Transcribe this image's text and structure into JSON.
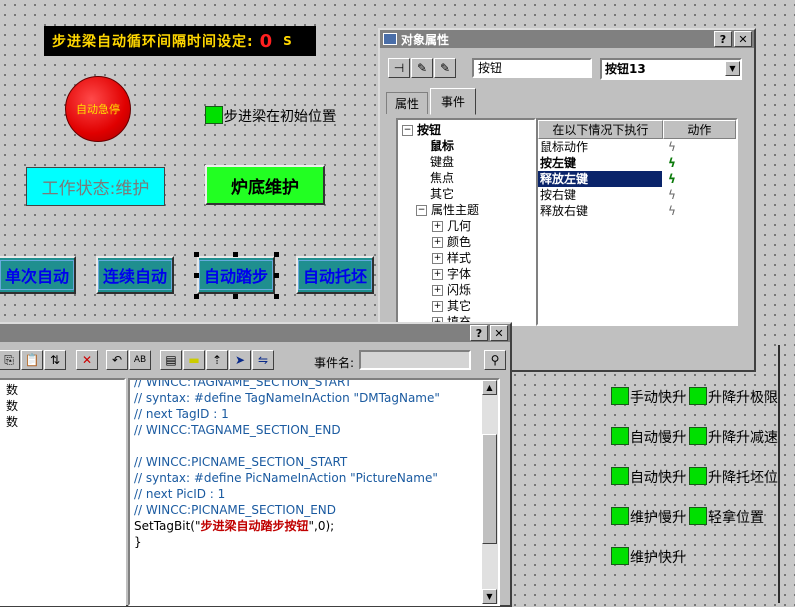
{
  "banner": {
    "label": "步进梁自动循环间隔时间设定:",
    "value": "0",
    "unit": "S"
  },
  "estop": {
    "label": "自动急停"
  },
  "init_position": {
    "label": "步进梁在初始位置"
  },
  "work_state": {
    "label": "工作状态:维护"
  },
  "furnace_btn": {
    "label": "炉底维护"
  },
  "mode_buttons": [
    {
      "label": "单次自动"
    },
    {
      "label": "连续自动"
    },
    {
      "label": "自动踏步"
    },
    {
      "label": "自动托坯"
    }
  ],
  "indicators": [
    {
      "label": "手动快升"
    },
    {
      "label": "升降升极限"
    },
    {
      "label": "自动慢升"
    },
    {
      "label": "升降升减速"
    },
    {
      "label": "自动快升"
    },
    {
      "label": "升降托坯位"
    },
    {
      "label": "维护慢升"
    },
    {
      "label": "轻拿位置"
    },
    {
      "label": "维护快升"
    }
  ],
  "props_dialog": {
    "title": "对象属性",
    "object_type": "按钮",
    "object_name": "按钮13",
    "tabs": [
      "属性",
      "事件"
    ],
    "tree": {
      "root": "按钮",
      "children": [
        "鼠标",
        "键盘",
        "焦点",
        "其它"
      ],
      "theme": "属性主题",
      "theme_children": [
        "几何",
        "颜色",
        "样式",
        "字体",
        "闪烁",
        "其它",
        "填充"
      ]
    },
    "list_headers": [
      "在以下情况下执行",
      "动作"
    ],
    "list_rows": [
      "鼠标动作",
      "按左键",
      "释放左键",
      "按右键",
      "释放右键"
    ]
  },
  "code_dialog": {
    "event_label": "事件名:",
    "left_items": [
      "数",
      "数",
      "数"
    ],
    "code": [
      "// WINCC:TAGNAME_SECTION_START",
      "// syntax: #define TagNameInAction \"DMTagName\"",
      "// next TagID : 1",
      "// WINCC:TAGNAME_SECTION_END",
      "",
      "// WINCC:PICNAME_SECTION_START",
      "// syntax: #define PicNameInAction \"PictureName\"",
      "// next PicID : 1",
      "// WINCC:PICNAME_SECTION_END"
    ],
    "call_prefix": "SetTagBit(\"",
    "call_arg": "步进梁自动踏步按钮",
    "call_suffix": "\",0);",
    "close_brace": "}"
  },
  "icons": [
    "estop-icon",
    "pin-icon",
    "wand-icon",
    "lightning-icon",
    "close-icon",
    "help-icon"
  ]
}
